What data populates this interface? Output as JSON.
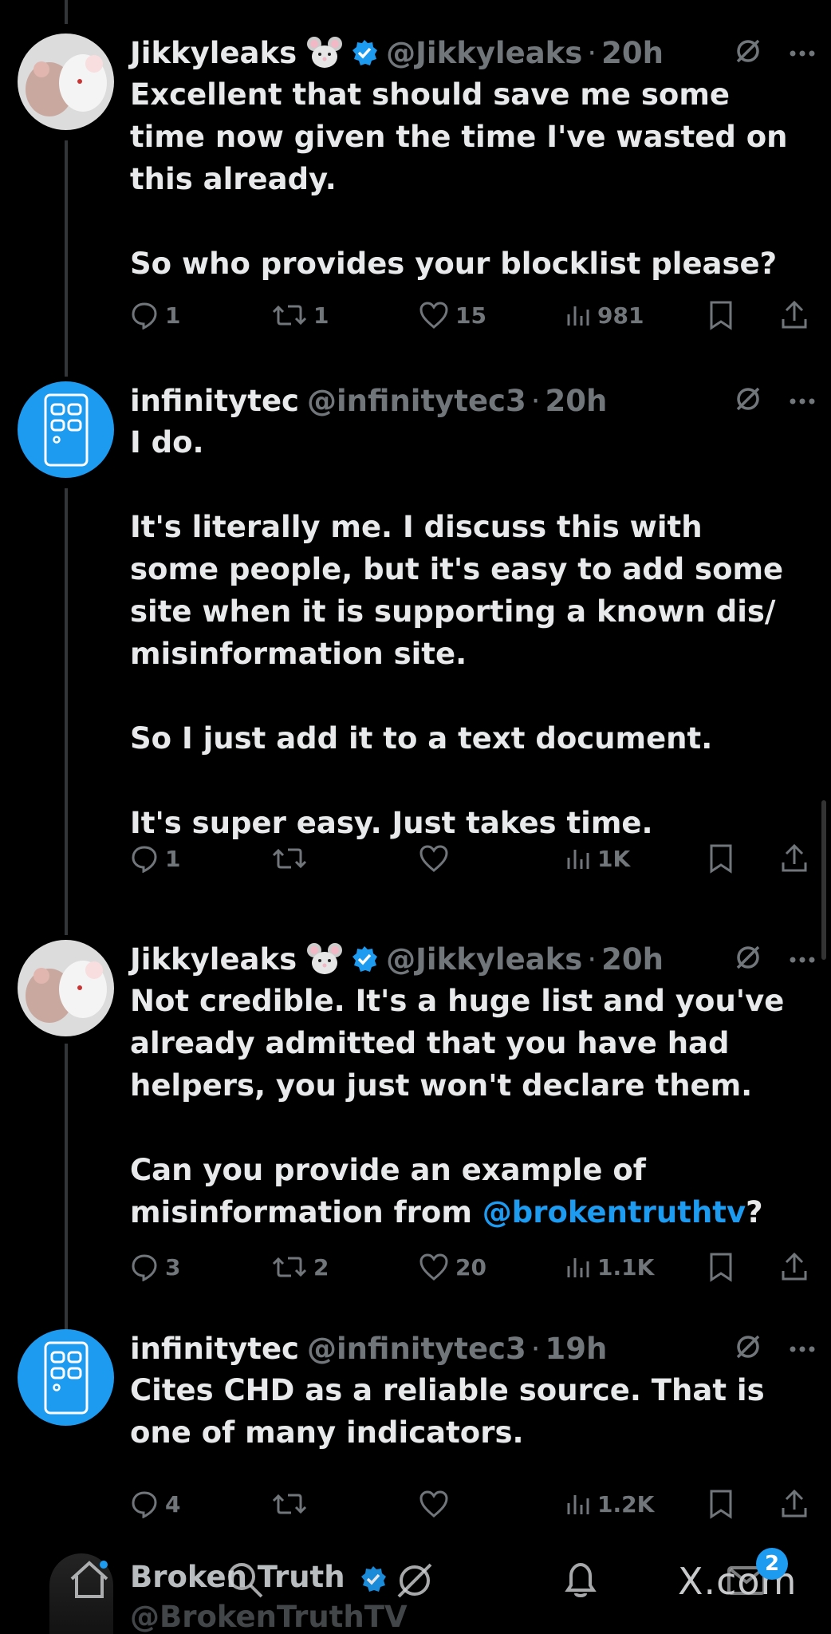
{
  "tweets": [
    {
      "name": "Jikkyleaks",
      "emoji": "mouse-face-emoji",
      "verified": true,
      "handle": "@Jikkyleaks",
      "dot": "·",
      "time": "20h",
      "text": "Excellent that should save me some time now given the time I've wasted on this already.\n\nSo who provides your blocklist please?",
      "replies": "1",
      "reposts": "1",
      "likes": "15",
      "views": "981"
    },
    {
      "name": "infinitytec",
      "handle": "@infinitytec3",
      "dot": "·",
      "time": "20h",
      "text": "I do.\n\nIt's literally me. I discuss this with some people, but it's easy to add some site when it is supporting a known dis/ misinformation site.\n\nSo I just add it to a text document.\n\nIt's super easy. Just takes time.",
      "replies": "1",
      "reposts": "",
      "likes": "",
      "views": "1K"
    },
    {
      "name": "Jikkyleaks",
      "emoji": "mouse-face-emoji",
      "verified": true,
      "handle": "@Jikkyleaks",
      "dot": "·",
      "time": "20h",
      "text_before": "Not credible. It's a huge list and you've already admitted that you have had helpers, you just won't declare them.\n\nCan you provide an example of misinformation from ",
      "mention": "@brokentruthtv",
      "text_after": "?",
      "replies": "3",
      "reposts": "2",
      "likes": "20",
      "views": "1.1K"
    },
    {
      "name": "infinitytec",
      "handle": "@infinitytec3",
      "dot": "·",
      "time": "19h",
      "text": "Cites CHD as a reliable source. That is one of many indicators.",
      "replies": "4",
      "reposts": "",
      "likes": "",
      "views": "1.2K"
    }
  ],
  "bottom": {
    "name": "Broken Truth",
    "handle": "@BrokenTruthTV",
    "messages_badge": "2",
    "watermark": "X.com"
  },
  "colors": {
    "background": "#000000",
    "text": "#e7e9ea",
    "muted": "#71767b",
    "accent": "#1d9bf0"
  }
}
